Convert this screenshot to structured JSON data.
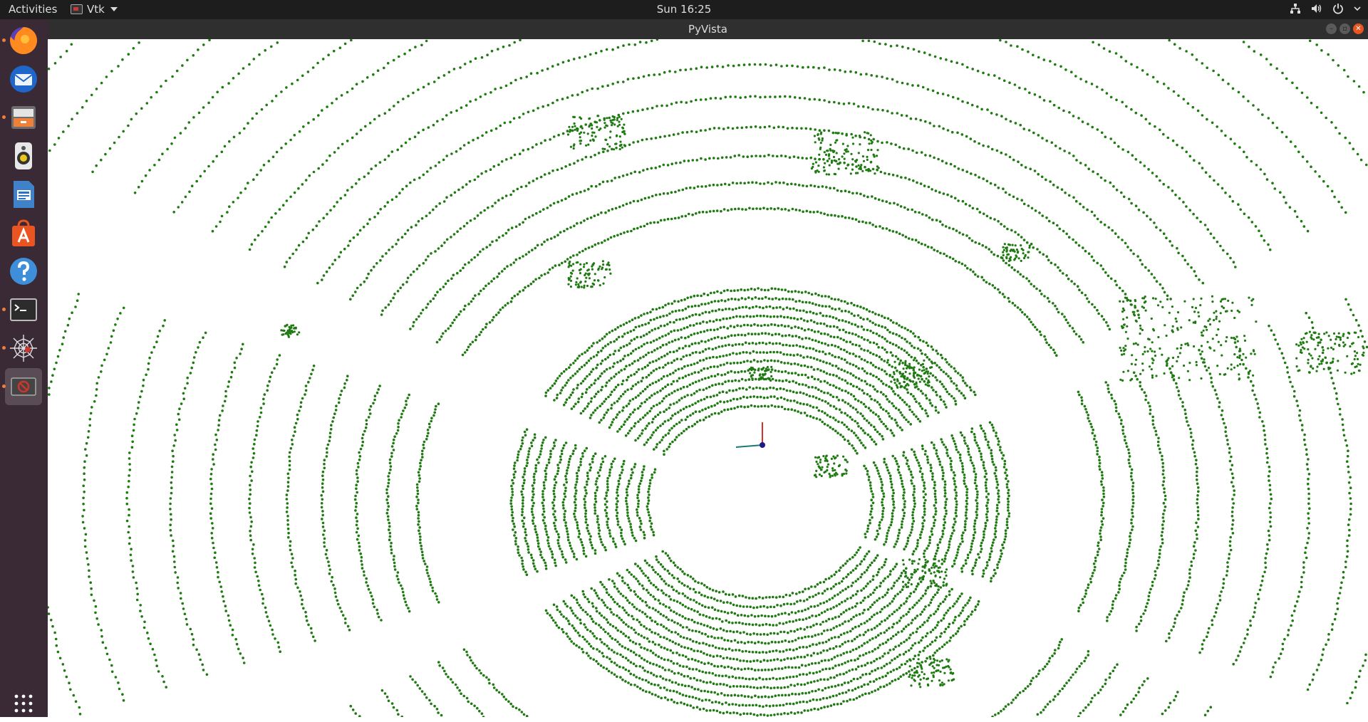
{
  "topbar": {
    "activities_label": "Activities",
    "app_name": "Vtk",
    "clock": "Sun 16:25"
  },
  "window": {
    "title": "PyVista"
  },
  "dock": {
    "items": [
      {
        "name": "firefox",
        "icon": "firefox-icon",
        "running": true
      },
      {
        "name": "thunderbird",
        "icon": "mail-icon",
        "running": false
      },
      {
        "name": "files",
        "icon": "files-icon",
        "running": true
      },
      {
        "name": "rhythmbox",
        "icon": "speaker-icon",
        "running": false
      },
      {
        "name": "libreoffice-writer",
        "icon": "writer-icon",
        "running": false
      },
      {
        "name": "software",
        "icon": "software-store-icon",
        "running": false
      },
      {
        "name": "help",
        "icon": "help-icon",
        "running": false
      },
      {
        "name": "terminal",
        "icon": "terminal-icon",
        "running": true
      },
      {
        "name": "spider",
        "icon": "spider-web-icon",
        "running": true
      },
      {
        "name": "vtk",
        "icon": "vtk-window-icon",
        "running": true
      }
    ],
    "show_apps_icon": "app-grid-icon"
  },
  "colors": {
    "points": "#1f7a12",
    "topbar": "#1d1d1d",
    "dock": "#3a2a35",
    "accent": "#e95420"
  }
}
